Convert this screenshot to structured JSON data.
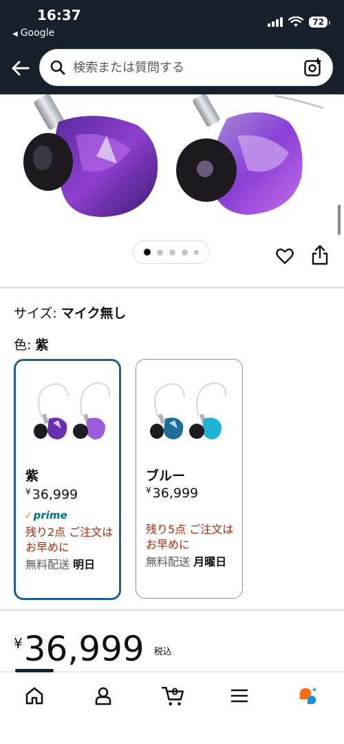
{
  "status_bar": {
    "time": "16:37",
    "back_app": "Google",
    "battery": "72"
  },
  "header": {
    "search_placeholder": "検索または質問する"
  },
  "gallery": {
    "image_count": 5,
    "active_index": 0
  },
  "variations": {
    "size_label": "サイズ: ",
    "size_value": "マイク無し",
    "color_label": "色: ",
    "color_value": "紫",
    "options": [
      {
        "name": "紫",
        "currency": "¥",
        "price": "36,999",
        "prime": "prime",
        "stock": "残り2点 ご注文はお早めに",
        "delivery_label": "無料配送 ",
        "delivery_day": "明日",
        "selected": true
      },
      {
        "name": "ブルー",
        "currency": "¥",
        "price": "36,999",
        "stock": "残り5点 ご注文はお早めに",
        "delivery_label": "無料配送 ",
        "delivery_day": "月曜日",
        "selected": false
      }
    ]
  },
  "price": {
    "currency": "¥",
    "amount": "36,999",
    "tax_note": "税込"
  },
  "bottom_nav": {
    "items": [
      "home-icon",
      "account-icon",
      "cart-icon",
      "menu-icon",
      "rufus-icon"
    ],
    "cart_count": "0"
  },
  "colors": {
    "header_bg": "#15202b",
    "selected_border": "#1f5e8d",
    "stock_red": "#b12704",
    "prime_blue": "#007185",
    "prime_check": "#ff9900",
    "rufus_orange": "#ff6a13",
    "rufus_blue": "#1c8de0"
  }
}
